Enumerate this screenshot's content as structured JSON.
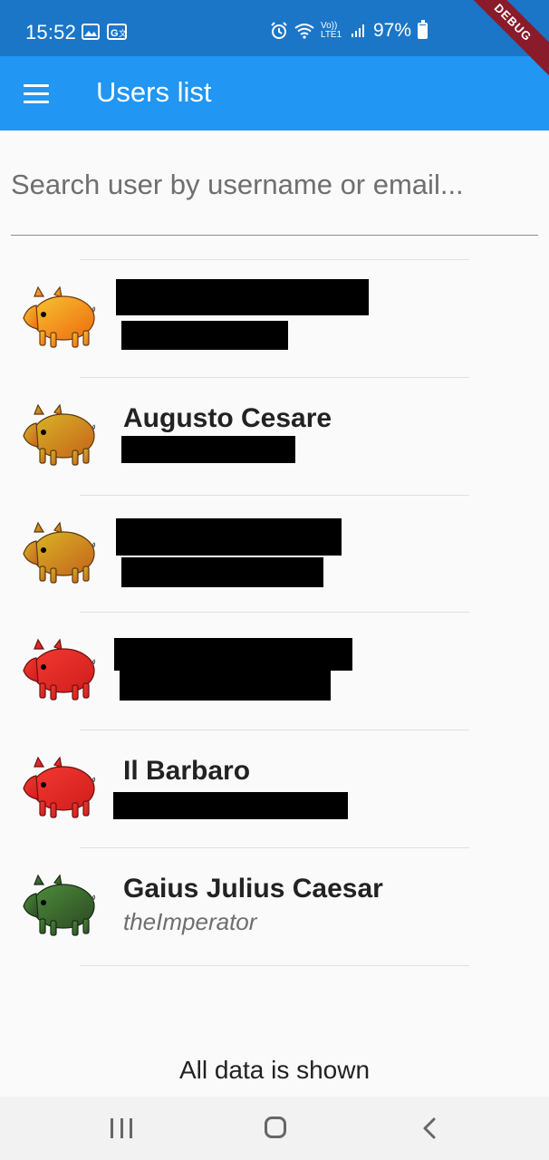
{
  "status_bar": {
    "time": "15:52",
    "network": "Vo)) LTE1",
    "battery": "97%",
    "debug_label": "DEBUG"
  },
  "app_bar": {
    "title": "Users list",
    "menu_icon": "hamburger-menu-icon",
    "background": "#2196f3"
  },
  "search": {
    "placeholder": "Search user by username or email...",
    "value": ""
  },
  "users": [
    {
      "name": "",
      "username": "",
      "avatar_color": "orange",
      "redacted": true
    },
    {
      "name": "Augusto Cesare",
      "username": "",
      "avatar_color": "gold",
      "redacted_username": true
    },
    {
      "name": "",
      "username": "",
      "avatar_color": "gold",
      "redacted": true
    },
    {
      "name": "",
      "username": "",
      "avatar_color": "red",
      "redacted": true
    },
    {
      "name": "Il Barbaro",
      "username": "",
      "avatar_color": "red",
      "redacted_username": true
    },
    {
      "name": "Gaius Julius Caesar",
      "username": "theImperator",
      "avatar_color": "green"
    }
  ],
  "footer": {
    "text": "All data is shown"
  },
  "nav_bar": {
    "recents": "recents-icon",
    "home": "home-icon",
    "back": "back-icon"
  }
}
